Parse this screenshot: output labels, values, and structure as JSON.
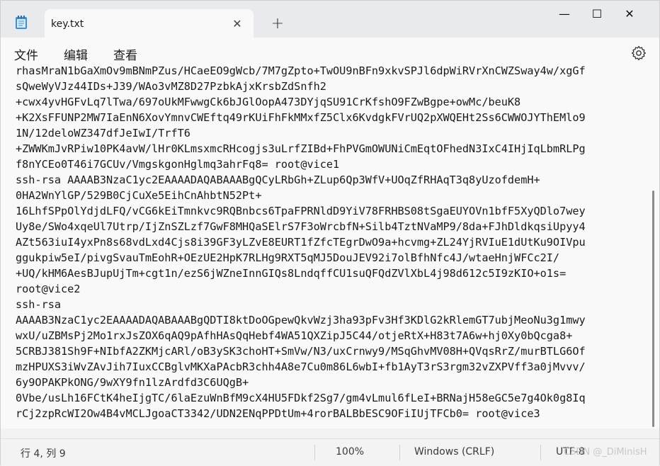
{
  "tab": {
    "title": "key.txt",
    "close_glyph": "✕",
    "new_tab_glyph": "+"
  },
  "window_controls": {
    "minimize": "—",
    "maximize": "☐",
    "close": "✕"
  },
  "menu": {
    "items": [
      "文件",
      "编辑",
      "查看"
    ]
  },
  "editor": {
    "lines": [
      "rhasMraN1bGaXmOv9mBNmPZus/HCaeEO9gWcb/7M7gZpto+TwOU9nBFn9xkvSPJl6dpWiRVrXnCWZSway4w/xgGf",
      "sQweWyVJz44IDs+J39/WAo3vMZ8D27PzbkAjxKrsbZdSnfh2",
      "+cwx4yvHGFvLq7lTwa/697oUkMFwwgCk6bJGlOopA473DYjqSU91CrKfshO9FZwBgpe+owMc/beuK8",
      "+K2XsFFUNP2MW7IaEnN6XovYmnvCWEftq49rKUiFhFkMMxfZ5Clx6KvdgkFVrUQ2pXWQEHt2Ss6CWWOJYThEMlo9",
      "1N/12deloWZ347dfJeIwI/TrfT6",
      "+ZWWKmJvRPiw10PK4avW/lHr0KLmsxmcRHcogjs3uLrfZIBd+FhPVGmOWUNiCmEqtOFhedN3IxC4IHjIqLbmRLPg",
      "f8nYCEo0T46i7GCUv/VmgskgonHglmq3ahrFq8= root@vice1",
      "ssh-rsa AAAAB3NzaC1yc2EAAAADAQABAAABgQCyLRbGh+ZLup6Qp3WfV+UOqZfRHAqT3q8yUzofdemH+",
      "0HA2WnYlGP/529B0CjCuXe5EihCnAhbtN52Pt+",
      "16LhfSPpOlYdjdLFQ/vCG6kEiTmnkvc9RQBnbcs6TpaFPRNldD9YiV78FRHBS08tSgaEUYOVn1bfF5XyQDlo7wey",
      "Uy8e/SWo4xqeUl7Utrp/IjZnSZLzf7GwF8MHQaSElrS7F3oWrcbfN+Silb4TztNVaMP9/8da+FJhDldkqsiUpyy4",
      "AZt563iuI4yxPn8s68vdLxd4Cjs8i39GF3yLZvE8EURT1fZfcTEgrDwO9a+hcvmg+ZL24YjRVIuE1dUtKu9OIVpu",
      "ggukpiw5eI/pivgSvauTmEohR+OEzUE2HpK7RLHg9RXT5qMJ5DouJEV92i7olBfhNfc4J/wtaeHnjWFCc2I/",
      "+UQ/kHM6AesBJupUjTm+cgt1n/ezS6jWZneInnGIQs8LndqffCU1suQFQdZVlXbL4j98d612c5I9zKIO+o1s=",
      "root@vice2",
      "ssh-rsa",
      "AAAAB3NzaC1yc2EAAAADAQABAAABgQDTI8ktDoOGpewQkvWzj3ha93pFv3Hf3KDlG2kRlemGT7ubjMeoNu3g1mwy",
      "wxU/uZBMsPj2Mo1rxJsZOX6qAQ9pAfhHAsQqHebf4WA51QXZipJ5C44/otjeRtX+H83t7A6w+hj0Xy0bQcga8+",
      "5CRBJ381Sh9F+NIbfA2ZKMjcARl/oB3ySK3choHT+SmVw/N3/uxCrnwy9/MSqGhvMV08H+QVqsRrZ/murBTLG6Of",
      "mzHPUXS3iWvZAvJih7IuxCCBglvMKXaPAcbR3chh4A8e7Cu0m86L6wbI+fb1AyT3rS3rgm32vZXPVff3a0jMvvv/",
      "6y9OPAKPkONG/9wXY9fn1lzArdfd3C6UQgB+",
      "0Vbe/usLh16FCtK4heIjgTC/6laEzuWnBfM9cX4HU5FDkf2Sg7/gm4vLmul6fLeI+BRNajH58eGC5e7g4Ok0g8Iq",
      "rCj2zpRcWI2Ow4B4vMCLJgoaCT3342/UDN2ENqPPDtUm+4rorBALBbESC9OFiIUjTFCb0= root@vice3"
    ]
  },
  "status": {
    "position": "行 4, 列 9",
    "zoom": "100%",
    "line_ending": "Windows (CRLF)",
    "encoding": "UTF-8"
  },
  "watermark": "CSDN @_DiMinisH"
}
